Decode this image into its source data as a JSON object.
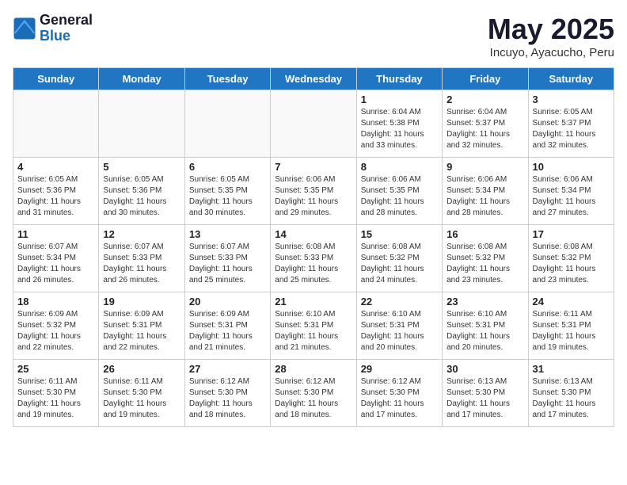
{
  "header": {
    "logo_general": "General",
    "logo_blue": "Blue",
    "month_title": "May 2025",
    "subtitle": "Incuyo, Ayacucho, Peru"
  },
  "days_of_week": [
    "Sunday",
    "Monday",
    "Tuesday",
    "Wednesday",
    "Thursday",
    "Friday",
    "Saturday"
  ],
  "weeks": [
    [
      {
        "day": "",
        "empty": true
      },
      {
        "day": "",
        "empty": true
      },
      {
        "day": "",
        "empty": true
      },
      {
        "day": "",
        "empty": true
      },
      {
        "day": "1",
        "sunrise": "6:04 AM",
        "sunset": "5:38 PM",
        "daylight": "11 hours and 33 minutes."
      },
      {
        "day": "2",
        "sunrise": "6:04 AM",
        "sunset": "5:37 PM",
        "daylight": "11 hours and 32 minutes."
      },
      {
        "day": "3",
        "sunrise": "6:05 AM",
        "sunset": "5:37 PM",
        "daylight": "11 hours and 32 minutes."
      }
    ],
    [
      {
        "day": "4",
        "sunrise": "6:05 AM",
        "sunset": "5:36 PM",
        "daylight": "11 hours and 31 minutes."
      },
      {
        "day": "5",
        "sunrise": "6:05 AM",
        "sunset": "5:36 PM",
        "daylight": "11 hours and 30 minutes."
      },
      {
        "day": "6",
        "sunrise": "6:05 AM",
        "sunset": "5:35 PM",
        "daylight": "11 hours and 30 minutes."
      },
      {
        "day": "7",
        "sunrise": "6:06 AM",
        "sunset": "5:35 PM",
        "daylight": "11 hours and 29 minutes."
      },
      {
        "day": "8",
        "sunrise": "6:06 AM",
        "sunset": "5:35 PM",
        "daylight": "11 hours and 28 minutes."
      },
      {
        "day": "9",
        "sunrise": "6:06 AM",
        "sunset": "5:34 PM",
        "daylight": "11 hours and 28 minutes."
      },
      {
        "day": "10",
        "sunrise": "6:06 AM",
        "sunset": "5:34 PM",
        "daylight": "11 hours and 27 minutes."
      }
    ],
    [
      {
        "day": "11",
        "sunrise": "6:07 AM",
        "sunset": "5:34 PM",
        "daylight": "11 hours and 26 minutes."
      },
      {
        "day": "12",
        "sunrise": "6:07 AM",
        "sunset": "5:33 PM",
        "daylight": "11 hours and 26 minutes."
      },
      {
        "day": "13",
        "sunrise": "6:07 AM",
        "sunset": "5:33 PM",
        "daylight": "11 hours and 25 minutes."
      },
      {
        "day": "14",
        "sunrise": "6:08 AM",
        "sunset": "5:33 PM",
        "daylight": "11 hours and 25 minutes."
      },
      {
        "day": "15",
        "sunrise": "6:08 AM",
        "sunset": "5:32 PM",
        "daylight": "11 hours and 24 minutes."
      },
      {
        "day": "16",
        "sunrise": "6:08 AM",
        "sunset": "5:32 PM",
        "daylight": "11 hours and 23 minutes."
      },
      {
        "day": "17",
        "sunrise": "6:08 AM",
        "sunset": "5:32 PM",
        "daylight": "11 hours and 23 minutes."
      }
    ],
    [
      {
        "day": "18",
        "sunrise": "6:09 AM",
        "sunset": "5:32 PM",
        "daylight": "11 hours and 22 minutes."
      },
      {
        "day": "19",
        "sunrise": "6:09 AM",
        "sunset": "5:31 PM",
        "daylight": "11 hours and 22 minutes."
      },
      {
        "day": "20",
        "sunrise": "6:09 AM",
        "sunset": "5:31 PM",
        "daylight": "11 hours and 21 minutes."
      },
      {
        "day": "21",
        "sunrise": "6:10 AM",
        "sunset": "5:31 PM",
        "daylight": "11 hours and 21 minutes."
      },
      {
        "day": "22",
        "sunrise": "6:10 AM",
        "sunset": "5:31 PM",
        "daylight": "11 hours and 20 minutes."
      },
      {
        "day": "23",
        "sunrise": "6:10 AM",
        "sunset": "5:31 PM",
        "daylight": "11 hours and 20 minutes."
      },
      {
        "day": "24",
        "sunrise": "6:11 AM",
        "sunset": "5:31 PM",
        "daylight": "11 hours and 19 minutes."
      }
    ],
    [
      {
        "day": "25",
        "sunrise": "6:11 AM",
        "sunset": "5:30 PM",
        "daylight": "11 hours and 19 minutes."
      },
      {
        "day": "26",
        "sunrise": "6:11 AM",
        "sunset": "5:30 PM",
        "daylight": "11 hours and 19 minutes."
      },
      {
        "day": "27",
        "sunrise": "6:12 AM",
        "sunset": "5:30 PM",
        "daylight": "11 hours and 18 minutes."
      },
      {
        "day": "28",
        "sunrise": "6:12 AM",
        "sunset": "5:30 PM",
        "daylight": "11 hours and 18 minutes."
      },
      {
        "day": "29",
        "sunrise": "6:12 AM",
        "sunset": "5:30 PM",
        "daylight": "11 hours and 17 minutes."
      },
      {
        "day": "30",
        "sunrise": "6:13 AM",
        "sunset": "5:30 PM",
        "daylight": "11 hours and 17 minutes."
      },
      {
        "day": "31",
        "sunrise": "6:13 AM",
        "sunset": "5:30 PM",
        "daylight": "11 hours and 17 minutes."
      }
    ]
  ]
}
